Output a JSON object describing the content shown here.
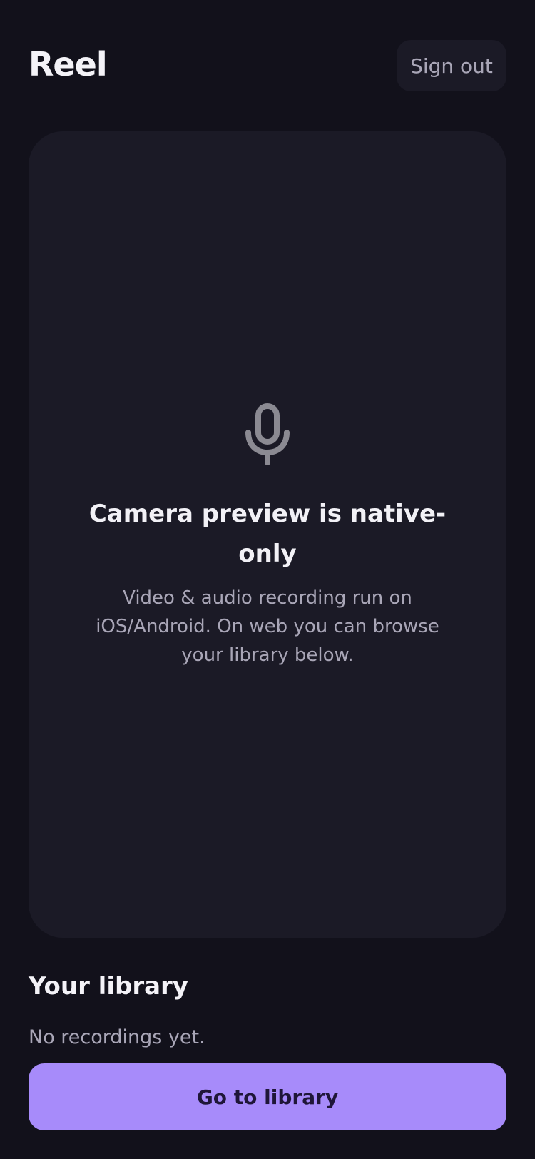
{
  "header": {
    "app_title": "Reel",
    "sign_out_label": "Sign out"
  },
  "preview": {
    "icon": "microphone-icon",
    "title": "Camera preview is native-only",
    "body": "Video & audio recording run on iOS/Android. On web you can browse your library below."
  },
  "library": {
    "heading": "Your library",
    "empty_message": "No recordings yet.",
    "button_label": "Go to library"
  },
  "colors": {
    "background": "#12111b",
    "card": "#1b1a26",
    "accent": "#a78bfa",
    "muted_text": "#a9a6b7",
    "icon": "#8b8a92"
  }
}
